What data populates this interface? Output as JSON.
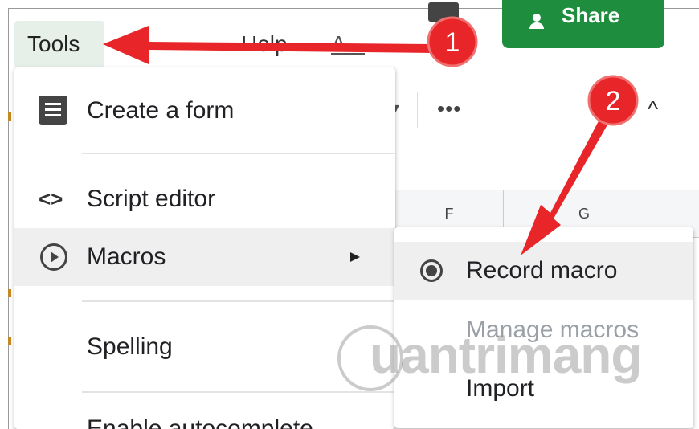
{
  "menubar": {
    "tools": "Tools",
    "help": "Help",
    "accessibility": "A..."
  },
  "share": {
    "label": "Share"
  },
  "toolbar": {
    "more": "•••",
    "collapse": "^",
    "dropdown": "▾"
  },
  "grid": {
    "columns": [
      "F",
      "G"
    ]
  },
  "tools_menu": {
    "items": [
      {
        "label": "Create a form",
        "icon": "form-icon"
      },
      {
        "label": "Script editor",
        "icon": "code-icon",
        "glyph": "<>"
      },
      {
        "label": "Macros",
        "icon": "play-circle-icon",
        "highlighted": true,
        "submenu": true
      },
      {
        "label": "Spelling"
      },
      {
        "label": "Enable autocomplete"
      }
    ]
  },
  "macros_submenu": {
    "items": [
      {
        "label": "Record macro",
        "icon": "record-icon",
        "highlighted": true
      },
      {
        "label": "Manage macros",
        "disabled": true
      },
      {
        "label": "Import"
      }
    ]
  },
  "annotations": [
    {
      "label": "1"
    },
    {
      "label": "2"
    }
  ],
  "watermark": {
    "text": "uantrimang"
  },
  "colors": {
    "share": "#1e8e3e",
    "annotation": "#e8262a",
    "highlight": "#efefef"
  }
}
